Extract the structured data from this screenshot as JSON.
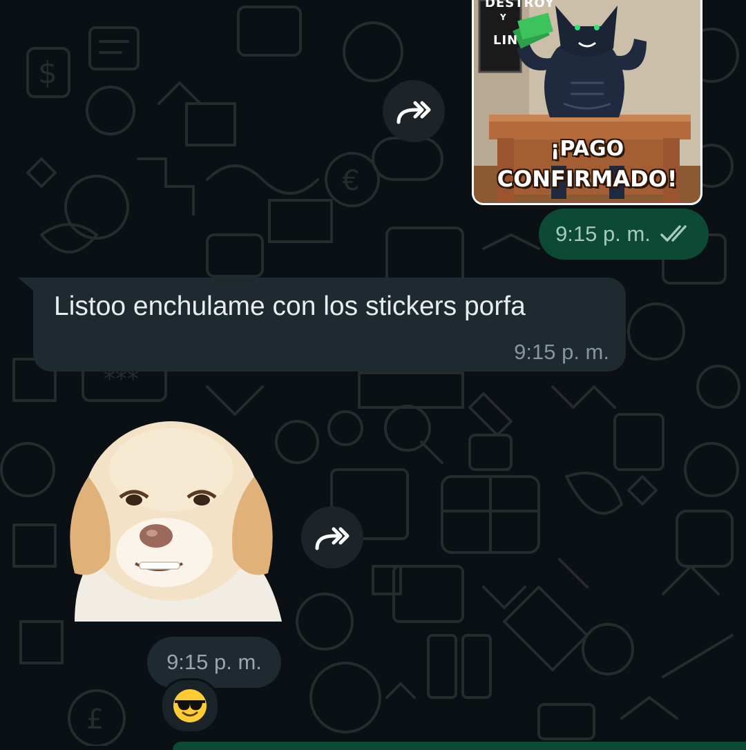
{
  "chat": {
    "messages": [
      {
        "direction": "outgoing",
        "kind": "sticker",
        "sticker_text_line1": "¡PAGO",
        "sticker_text_line2": "CONFIRMADO!",
        "board_text_1": "DESTROY",
        "board_text_2": "Y",
        "board_text_3": "LIN",
        "time": "9:15 p. m.",
        "status_icon": "double-check-icon",
        "forward_icon": "forward-icon"
      },
      {
        "direction": "incoming",
        "kind": "text",
        "text": "Listoo enchulame con los stickers porfa",
        "time": "9:15 p. m."
      },
      {
        "direction": "incoming",
        "kind": "sticker",
        "time": "9:15 p. m.",
        "forward_icon": "forward-icon",
        "reaction": "😎"
      }
    ]
  },
  "colors": {
    "background": "#0b1014",
    "outgoing_bubble": "#0d4a36",
    "incoming_bubble": "#1f2a30",
    "forward_button": "#1c2429"
  }
}
